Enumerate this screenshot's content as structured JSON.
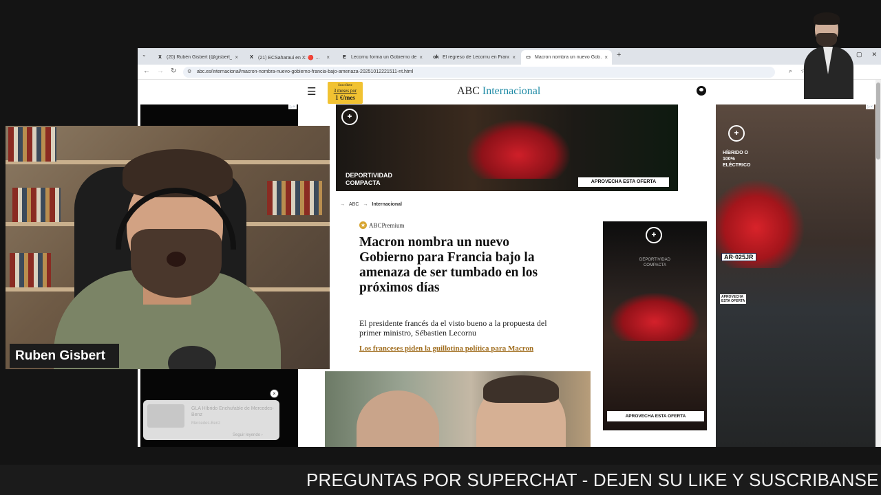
{
  "browser": {
    "tabs": [
      {
        "icon": "X",
        "label": "(20) Rubén Gisbert (@gisbert_…"
      },
      {
        "icon": "X",
        "label": "(21) ECSaharaui en X: 🔴 …"
      },
      {
        "icon": "E",
        "label": "Lecornu forma un Gobierno de…"
      },
      {
        "icon": "ok",
        "label": "El regreso de Lecornu en Franc…"
      },
      {
        "icon": "▭",
        "label": "Macron nombra un nuevo Gob…"
      }
    ],
    "active_tab": 4,
    "url": "abc.es/internacional/macron-nombra-nuevo-gobierno-francia-bajo-amenaza-20251012221511-nt.html",
    "new_tab": "+",
    "tab_close": "×",
    "window_controls": [
      "—",
      "▢",
      "✕"
    ]
  },
  "site": {
    "promo": {
      "line1": "Suscríbete",
      "line2": "3 meses por",
      "line3": "1 €/mes"
    },
    "brand_main": "ABC",
    "brand_section": "Internacional",
    "breadcrumb": [
      "ABC",
      "Internacional"
    ],
    "breadcrumb_arrow": "→"
  },
  "ads": {
    "top": {
      "tagline": "DEPORTIVIDAD\nCOMPACTA",
      "cta": "APROVECHA ESTA OFERTA"
    },
    "right": {
      "tagline": "HÍBRIDO O\n100%\nELÉCTRICO",
      "plate": "AR·025JR",
      "cta": "APROVECHA\nESTA OFERTA"
    },
    "side": {
      "tagline": "DEPORTIVIDAD\nCOMPACTA",
      "cta": "APROVECHA ESTA OFERTA"
    },
    "ad_tag": "▷×"
  },
  "article": {
    "premium_label": "ABCPremium",
    "headline": "Macron nombra un nuevo Gobierno para Francia bajo la amenaza de ser tumbado en los próximos días",
    "subtitle": "El presidente francés da el visto bueno a la propuesta del primer ministro, Sébastien Lecornu",
    "related_link": "Los franceses piden la guillotina política para Macron"
  },
  "notification": {
    "title": "GLA Híbrido Enchufable de Mercedes-Benz",
    "source": "Mercedes-Benz",
    "more": "Seguir leyendo ›",
    "close": "×"
  },
  "streamer": {
    "name": "Ruben Gisbert"
  },
  "ticker": {
    "text": "PREGUNTAS POR SUPERCHAT - DEJEN SU LIKE Y SUSCRIBANSE - C"
  }
}
